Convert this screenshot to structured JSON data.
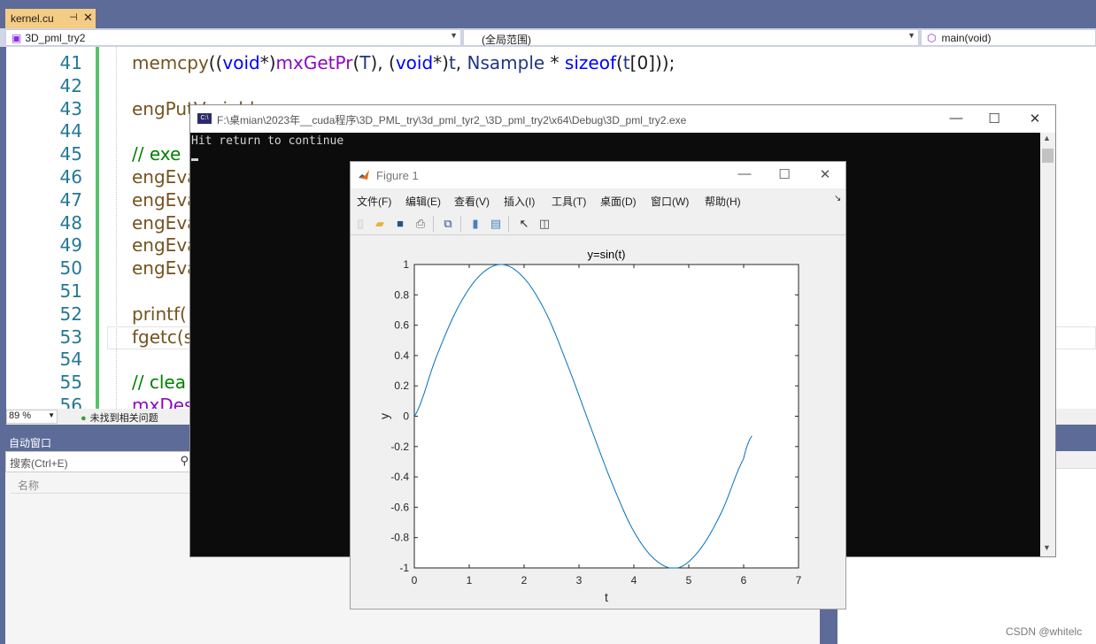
{
  "ide": {
    "doc_tab": {
      "label": "kernel.cu",
      "pin_glyph": "⊣",
      "close_glyph": "✕"
    },
    "nav": {
      "project": "3D_pml_try2",
      "scope": "(全局范围)",
      "member": "main(void)"
    },
    "lines": [
      {
        "num": "41",
        "html_key": "l41"
      },
      {
        "num": "42"
      },
      {
        "num": "43"
      },
      {
        "num": "44"
      },
      {
        "num": "45"
      },
      {
        "num": "46"
      },
      {
        "num": "47"
      },
      {
        "num": "48"
      },
      {
        "num": "49"
      },
      {
        "num": "50"
      },
      {
        "num": "51"
      },
      {
        "num": "52"
      },
      {
        "num": "53"
      },
      {
        "num": "54"
      },
      {
        "num": "55"
      },
      {
        "num": "56"
      }
    ],
    "code": {
      "l41": [
        [
          "fn",
          "memcpy"
        ],
        [
          "",
          "(("
        ],
        [
          "kw",
          "void"
        ],
        [
          "",
          "*)"
        ],
        [
          "mac",
          "mxGetPr"
        ],
        [
          "",
          "("
        ],
        [
          "var",
          "T"
        ],
        [
          "",
          "), ("
        ],
        [
          "kw",
          "void"
        ],
        [
          "",
          "*)"
        ],
        [
          "var",
          "t"
        ],
        [
          "",
          ", "
        ],
        [
          "var",
          "Nsample"
        ],
        [
          "",
          " * "
        ],
        [
          "kw",
          "sizeof"
        ],
        [
          "",
          "("
        ],
        [
          "var",
          "t"
        ],
        [
          "",
          "[0]));"
        ]
      ],
      "l43": "engPutVariable",
      "l45": "// exe",
      "l46": "engEva",
      "l47": "engEva",
      "l48": "engEva",
      "l49": "engEva",
      "l50": "engEva",
      "l52": "printf(",
      "l53": "fgetc(s",
      "l55": "// clea",
      "l56": "mxDes"
    },
    "status": {
      "zoom": "89 %",
      "issues": "未找到相关问题"
    },
    "panel": {
      "title": "自动窗口",
      "search_placeholder": "搜索(Ctrl+E)",
      "column_name": "名称"
    },
    "watermark": "CSDN @whitelc"
  },
  "console": {
    "title": "F:\\桌mian\\2023年__cuda程序\\3D_PML_try\\3d_pml_tyr2_\\3D_pml_try2\\x64\\Debug\\3D_pml_try2.exe",
    "icon_text": "C:\\",
    "output": "Hit return to continue"
  },
  "figure": {
    "title": "Figure 1",
    "menu": [
      "文件(F)",
      "编辑(E)",
      "查看(V)",
      "插入(I)",
      "工具(T)",
      "桌面(D)",
      "窗口(W)",
      "帮助(H)"
    ],
    "toolbar_icons": [
      "new-file-icon",
      "open-folder-icon",
      "save-icon",
      "print-icon",
      "link-plot-icon",
      "colorbar-icon",
      "legend-icon",
      "pointer-icon",
      "property-editor-icon"
    ]
  },
  "chart_data": {
    "type": "line",
    "title": "y=sin(t)",
    "xlabel": "t",
    "ylabel": "y",
    "xlim": [
      0,
      7
    ],
    "ylim": [
      -1,
      1
    ],
    "xticks": [
      "0",
      "1",
      "2",
      "3",
      "4",
      "5",
      "6",
      "7"
    ],
    "yticks": [
      "-1",
      "-0.8",
      "-0.6",
      "-0.4",
      "-0.2",
      "0",
      "0.2",
      "0.4",
      "0.6",
      "0.8",
      "1"
    ],
    "grid": false,
    "line_color": "#0072bd",
    "series": [
      {
        "x": [
          0,
          0.4,
          0.8,
          1.2,
          1.6,
          2.0,
          2.4,
          2.8,
          3.2,
          3.6,
          4.0,
          4.4,
          4.8,
          5.2,
          5.6,
          6.0,
          6.15
        ],
        "values": [
          0,
          0.39,
          0.72,
          0.93,
          1.0,
          0.91,
          0.68,
          0.33,
          -0.06,
          -0.44,
          -0.76,
          -0.95,
          -1.0,
          -0.88,
          -0.63,
          -0.28,
          -0.13
        ]
      }
    ]
  }
}
